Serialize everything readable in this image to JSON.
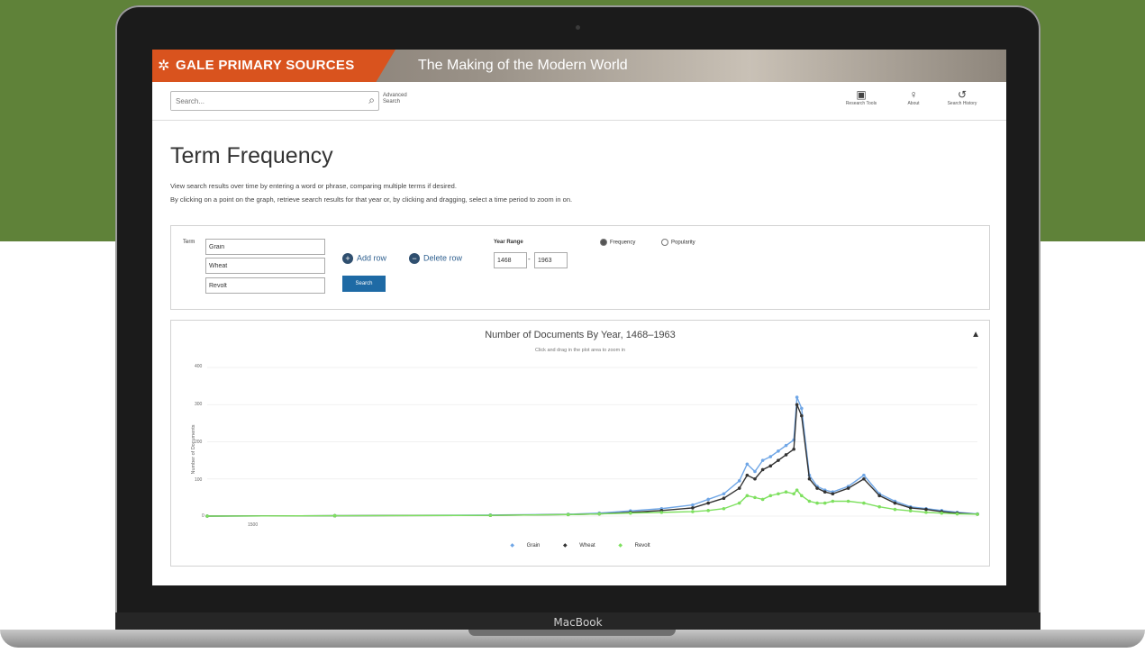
{
  "device": {
    "label": "MacBook"
  },
  "header": {
    "brand": "GALE PRIMARY SOURCES",
    "collection": "The Making of the Modern World",
    "brand_color": "#d9531e"
  },
  "toolbar": {
    "search_placeholder": "Search...",
    "advanced_search": "Advanced Search",
    "tools": [
      {
        "label": "Research Tools",
        "icon": "research-tools-icon"
      },
      {
        "label": "About",
        "icon": "lightbulb-icon"
      },
      {
        "label": "Search History",
        "icon": "history-icon"
      }
    ]
  },
  "page": {
    "title": "Term Frequency",
    "description_1": "View search results over time by entering a word or phrase, comparing multiple terms if desired.",
    "description_2": "By clicking on a point on the graph, retrieve search results for that year or, by clicking and dragging, select a time period to zoom in on."
  },
  "form": {
    "term_label": "Term",
    "terms": [
      "Grain",
      "Wheat",
      "Revolt"
    ],
    "add_row": "Add row",
    "delete_row": "Delete row",
    "search_button": "Search",
    "year_range_label": "Year Range",
    "year_from": "1468",
    "year_to": "1963",
    "radio_options": [
      {
        "label": "Frequency",
        "selected": true
      },
      {
        "label": "Popularity",
        "selected": false
      }
    ]
  },
  "chart_data": {
    "type": "line",
    "title": "Number of Documents By Year, 1468–1963",
    "subtitle": "Click and drag in the plot area to zoom in",
    "ylabel": "Number of Documents",
    "x_tick": "1500",
    "ylim": [
      0,
      400
    ],
    "y_ticks": [
      "400",
      "300",
      "200",
      "100",
      "0"
    ],
    "x": [
      1468,
      1550,
      1650,
      1700,
      1720,
      1740,
      1760,
      1780,
      1790,
      1800,
      1810,
      1815,
      1820,
      1825,
      1830,
      1835,
      1840,
      1845,
      1847,
      1850,
      1855,
      1860,
      1865,
      1870,
      1880,
      1890,
      1900,
      1910,
      1920,
      1930,
      1940,
      1950,
      1963
    ],
    "series": [
      {
        "name": "Grain",
        "color": "#6fa6e6",
        "values": [
          0,
          1,
          3,
          5,
          8,
          14,
          20,
          30,
          45,
          60,
          95,
          140,
          120,
          150,
          160,
          175,
          190,
          205,
          320,
          290,
          110,
          80,
          70,
          65,
          80,
          110,
          60,
          40,
          25,
          20,
          15,
          10,
          6
        ]
      },
      {
        "name": "Wheat",
        "color": "#333333",
        "values": [
          0,
          1,
          2,
          4,
          6,
          10,
          15,
          22,
          35,
          48,
          75,
          110,
          100,
          125,
          135,
          150,
          165,
          180,
          300,
          270,
          100,
          75,
          65,
          60,
          75,
          100,
          55,
          35,
          22,
          18,
          12,
          8,
          5
        ]
      },
      {
        "name": "Revolt",
        "color": "#7ee05f",
        "values": [
          0,
          1,
          2,
          4,
          6,
          8,
          10,
          12,
          15,
          20,
          35,
          55,
          50,
          45,
          55,
          60,
          65,
          60,
          70,
          55,
          40,
          35,
          35,
          40,
          40,
          35,
          25,
          18,
          14,
          10,
          8,
          6,
          5
        ]
      }
    ],
    "legend": [
      "Grain",
      "Wheat",
      "Revolt"
    ],
    "legend_position": "bottom-center",
    "grid": true
  }
}
